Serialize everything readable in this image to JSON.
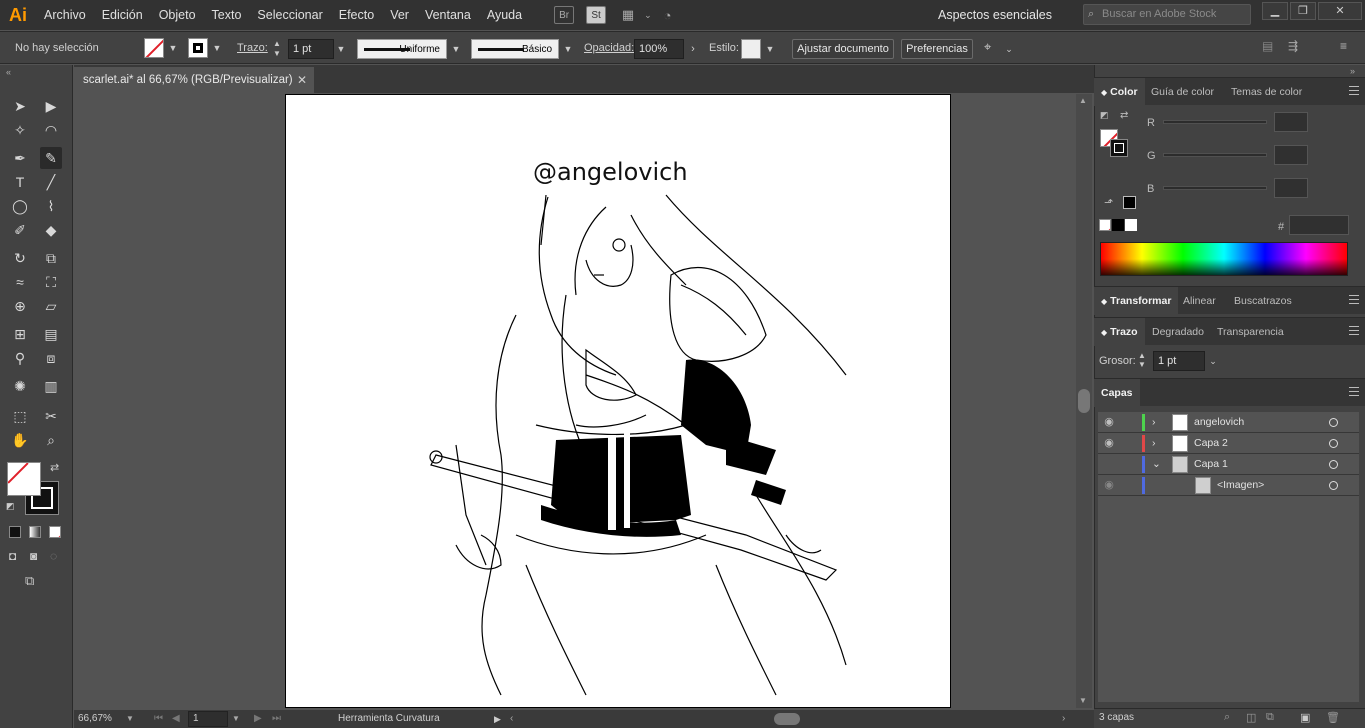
{
  "menubar": {
    "logo": "Ai",
    "items": [
      "Archivo",
      "Edición",
      "Objeto",
      "Texto",
      "Seleccionar",
      "Efecto",
      "Ver",
      "Ventana",
      "Ayuda"
    ],
    "icons": [
      "Br",
      "St"
    ],
    "workspace": "Aspectos esenciales",
    "search_placeholder": "Buscar en Adobe Stock"
  },
  "controlbar": {
    "selection": "No hay selección",
    "stroke_label": "Trazo:",
    "stroke_weight": "1 pt",
    "profile_uniform": "Uniforme",
    "brush_basic": "Básico",
    "opacity_label": "Opacidad:",
    "opacity_value": "100%",
    "style_label": "Estilo:",
    "adjust_doc": "Ajustar documento",
    "preferences": "Preferencias"
  },
  "document": {
    "tab_title": "scarlet.ai* al 66,67% (RGB/Previsualizar)",
    "caption": "@angelovich"
  },
  "statusbar": {
    "zoom": "66,67%",
    "artboard_num": "1",
    "tool_name": "Herramienta Curvatura"
  },
  "color_panel": {
    "tabs": [
      "Color",
      "Guía de color",
      "Temas de color"
    ],
    "r_label": "R",
    "g_label": "G",
    "b_label": "B",
    "hex_label": "#"
  },
  "transform_tabs": [
    "Transformar",
    "Alinear",
    "Buscatrazos"
  ],
  "stroke_panel": {
    "tabs": [
      "Trazo",
      "Degradado",
      "Transparencia"
    ],
    "weight_label": "Grosor:",
    "weight_value": "1 pt"
  },
  "layers_panel": {
    "title": "Capas",
    "layers": [
      {
        "name": "angelovich",
        "color": "#4dd34d"
      },
      {
        "name": "Capa 2",
        "color": "#e04848"
      },
      {
        "name": "Capa 1",
        "color": "#4f6ae0"
      },
      {
        "name": "<Imagen>",
        "color": "#4f6ae0"
      }
    ],
    "count": "3 capas"
  }
}
